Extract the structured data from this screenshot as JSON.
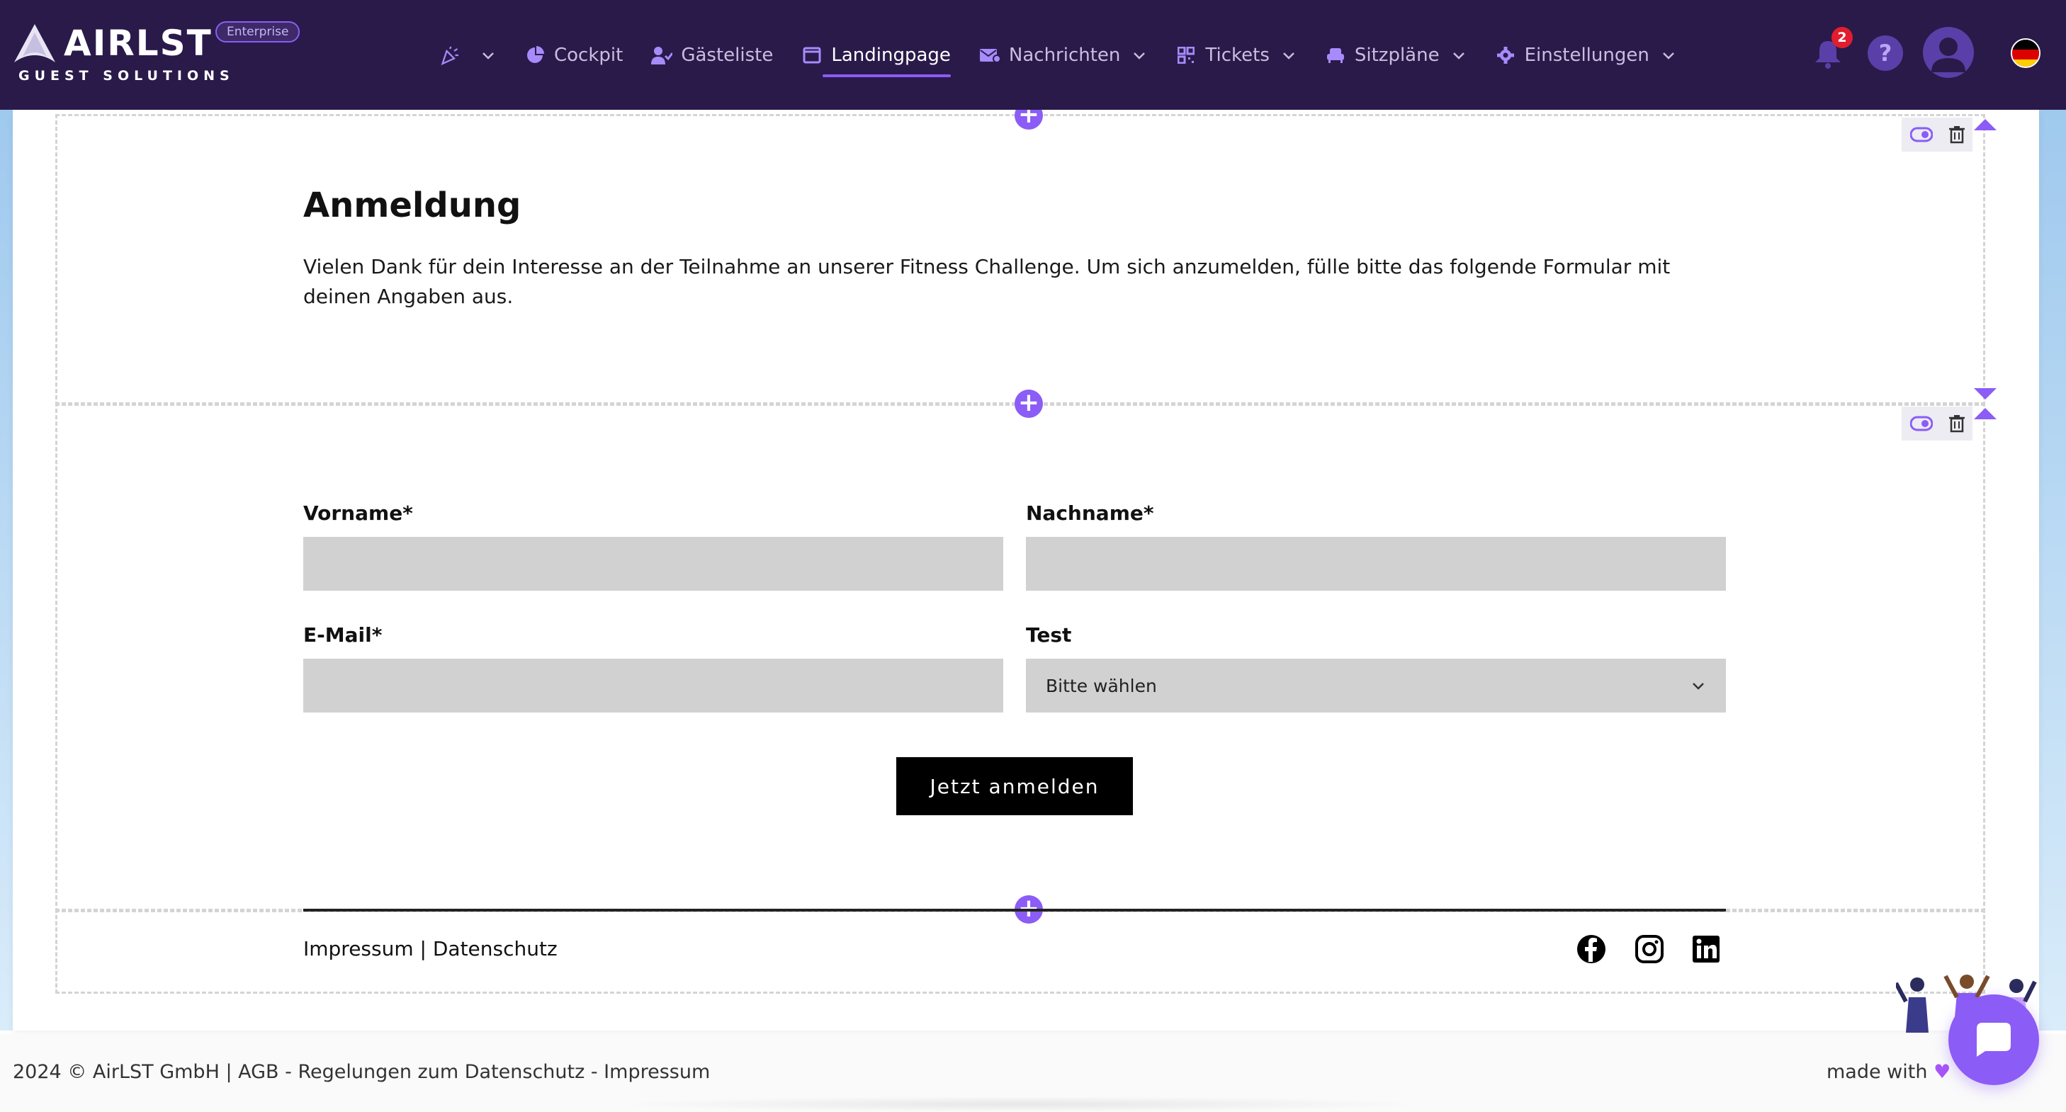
{
  "brand": {
    "name": "AIRLST",
    "tagline": "GUEST SOLUTIONS",
    "badge": "Enterprise",
    "accent": "#8b5cf6",
    "nav_bg": "#2a1a4a"
  },
  "nav": {
    "items": [
      {
        "label": "",
        "icon": "party-popper-icon"
      },
      {
        "label": "Cockpit",
        "icon": "pie-chart-icon"
      },
      {
        "label": "Gästeliste",
        "icon": "user-check-icon"
      },
      {
        "label": "Landingpage",
        "icon": "window-icon",
        "active": true
      },
      {
        "label": "Nachrichten",
        "icon": "mail-icon"
      },
      {
        "label": "Tickets",
        "icon": "qr-code-icon"
      },
      {
        "label": "Sitzpläne",
        "icon": "armchair-icon"
      },
      {
        "label": "Einstellungen",
        "icon": "gear-icon"
      }
    ],
    "notifications_count": "2",
    "help_label": "?"
  },
  "content": {
    "title": "Anmeldung",
    "intro": "Vielen Dank für dein Interesse an der Teilnahme an unserer Fitness Challenge. Um sich anzumelden, fülle bitte das folgende Formular mit deinen Angaben aus.",
    "form": {
      "firstname_label": "Vorname*",
      "firstname_value": "",
      "lastname_label": "Nachname*",
      "lastname_value": "",
      "email_label": "E-Mail*",
      "email_value": "",
      "test_label": "Test",
      "test_selected": "Bitte wählen",
      "submit_label": "Jetzt anmelden"
    },
    "footer_links": "Impressum | Datenschutz",
    "social": [
      "facebook-icon",
      "instagram-icon",
      "linkedin-icon"
    ]
  },
  "footer": {
    "copyright": "2024 © AirLST GmbH | AGB - Regelungen zum Datenschutz - Impressum",
    "made_with": "made with"
  }
}
